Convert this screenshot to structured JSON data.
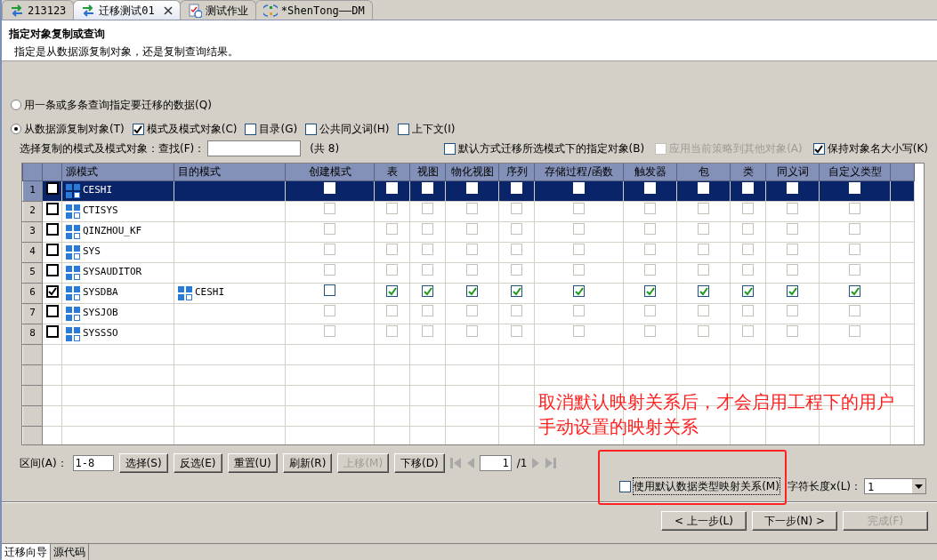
{
  "editor_tabs": [
    {
      "label": "213123",
      "kind": "connection",
      "selected": false,
      "closable": false
    },
    {
      "label": "迁移测试01",
      "kind": "connection",
      "selected": true,
      "closable": true
    },
    {
      "label": "测试作业",
      "kind": "job",
      "selected": false,
      "closable": false
    },
    {
      "label": "*ShenTong——DM",
      "kind": "model",
      "selected": false,
      "closable": false
    }
  ],
  "header": {
    "title": "指定对象复制或查询",
    "subtitle": "指定是从数据源复制对象，还是复制查询结果。"
  },
  "source_radios": [
    {
      "label": "用一条或多条查询指定要迁移的数据(Q)",
      "selected": false
    },
    {
      "label": "从数据源复制对象(T)",
      "selected": true
    }
  ],
  "object_types": [
    {
      "label": "模式及模式对象(C)",
      "checked": true
    },
    {
      "label": "目录(G)",
      "checked": false
    },
    {
      "label": "公共同义词(H)",
      "checked": false
    },
    {
      "label": "上下文(I)",
      "checked": false
    }
  ],
  "find": {
    "label": "选择复制的模式及模式对象：查找(F)：",
    "count": "(共 8)"
  },
  "options": [
    {
      "label": "默认方式迁移所选模式下的指定对象(B)",
      "checked": false,
      "disabled": false
    },
    {
      "label": "应用当前策略到其他对象(A)",
      "checked": false,
      "disabled": true
    },
    {
      "label": "保持对象名大小写(K)",
      "checked": true,
      "disabled": false
    }
  ],
  "table": {
    "columns": [
      "源模式",
      "目的模式",
      "创建模式",
      "表",
      "视图",
      "物化视图",
      "序列",
      "存储过程/函数",
      "触发器",
      "包",
      "类",
      "同义词",
      "自定义类型"
    ],
    "rows": [
      {
        "num": "1",
        "selected": true,
        "checked": false,
        "source": "CESHI",
        "target": "",
        "flags": [
          {
            "checked": false,
            "disabled": false
          },
          {
            "checked": false,
            "disabled": false
          },
          {
            "checked": false,
            "disabled": false
          },
          {
            "checked": false,
            "disabled": false
          },
          {
            "checked": false,
            "disabled": false
          },
          {
            "checked": false,
            "disabled": false
          },
          {
            "checked": false,
            "disabled": false
          },
          {
            "checked": false,
            "disabled": false
          },
          {
            "checked": false,
            "disabled": false
          },
          {
            "checked": false,
            "disabled": false
          },
          {
            "checked": false,
            "disabled": false
          }
        ]
      },
      {
        "num": "2",
        "selected": false,
        "checked": false,
        "source": "CTISYS",
        "target": "",
        "flags": [
          {
            "checked": false,
            "disabled": true
          },
          {
            "checked": false,
            "disabled": true
          },
          {
            "checked": false,
            "disabled": true
          },
          {
            "checked": false,
            "disabled": true
          },
          {
            "checked": false,
            "disabled": true
          },
          {
            "checked": false,
            "disabled": true
          },
          {
            "checked": false,
            "disabled": true
          },
          {
            "checked": false,
            "disabled": true
          },
          {
            "checked": false,
            "disabled": true
          },
          {
            "checked": false,
            "disabled": true
          },
          {
            "checked": false,
            "disabled": true
          }
        ]
      },
      {
        "num": "3",
        "selected": false,
        "checked": false,
        "source": "QINZHOU_KF",
        "target": "",
        "flags": [
          {
            "checked": false,
            "disabled": true
          },
          {
            "checked": false,
            "disabled": true
          },
          {
            "checked": false,
            "disabled": true
          },
          {
            "checked": false,
            "disabled": true
          },
          {
            "checked": false,
            "disabled": true
          },
          {
            "checked": false,
            "disabled": true
          },
          {
            "checked": false,
            "disabled": true
          },
          {
            "checked": false,
            "disabled": true
          },
          {
            "checked": false,
            "disabled": true
          },
          {
            "checked": false,
            "disabled": true
          },
          {
            "checked": false,
            "disabled": true
          }
        ]
      },
      {
        "num": "4",
        "selected": false,
        "checked": false,
        "source": "SYS",
        "target": "",
        "flags": [
          {
            "checked": false,
            "disabled": true
          },
          {
            "checked": false,
            "disabled": true
          },
          {
            "checked": false,
            "disabled": true
          },
          {
            "checked": false,
            "disabled": true
          },
          {
            "checked": false,
            "disabled": true
          },
          {
            "checked": false,
            "disabled": true
          },
          {
            "checked": false,
            "disabled": true
          },
          {
            "checked": false,
            "disabled": true
          },
          {
            "checked": false,
            "disabled": true
          },
          {
            "checked": false,
            "disabled": true
          },
          {
            "checked": false,
            "disabled": true
          }
        ]
      },
      {
        "num": "5",
        "selected": false,
        "checked": false,
        "source": "SYSAUDITOR",
        "target": "",
        "flags": [
          {
            "checked": false,
            "disabled": true
          },
          {
            "checked": false,
            "disabled": true
          },
          {
            "checked": false,
            "disabled": true
          },
          {
            "checked": false,
            "disabled": true
          },
          {
            "checked": false,
            "disabled": true
          },
          {
            "checked": false,
            "disabled": true
          },
          {
            "checked": false,
            "disabled": true
          },
          {
            "checked": false,
            "disabled": true
          },
          {
            "checked": false,
            "disabled": true
          },
          {
            "checked": false,
            "disabled": true
          },
          {
            "checked": false,
            "disabled": true
          }
        ]
      },
      {
        "num": "6",
        "selected": false,
        "checked": true,
        "source": "SYSDBA",
        "target": "CESHI",
        "flags": [
          {
            "checked": false,
            "disabled": false
          },
          {
            "checked": true,
            "disabled": false
          },
          {
            "checked": true,
            "disabled": false
          },
          {
            "checked": true,
            "disabled": false
          },
          {
            "checked": true,
            "disabled": false
          },
          {
            "checked": true,
            "disabled": false
          },
          {
            "checked": true,
            "disabled": false
          },
          {
            "checked": true,
            "disabled": false
          },
          {
            "checked": true,
            "disabled": false
          },
          {
            "checked": true,
            "disabled": false
          },
          {
            "checked": true,
            "disabled": false
          }
        ]
      },
      {
        "num": "7",
        "selected": false,
        "checked": false,
        "source": "SYSJOB",
        "target": "",
        "flags": [
          {
            "checked": false,
            "disabled": true
          },
          {
            "checked": false,
            "disabled": true
          },
          {
            "checked": false,
            "disabled": true
          },
          {
            "checked": false,
            "disabled": true
          },
          {
            "checked": false,
            "disabled": true
          },
          {
            "checked": false,
            "disabled": true
          },
          {
            "checked": false,
            "disabled": true
          },
          {
            "checked": false,
            "disabled": true
          },
          {
            "checked": false,
            "disabled": true
          },
          {
            "checked": false,
            "disabled": true
          },
          {
            "checked": false,
            "disabled": true
          }
        ]
      },
      {
        "num": "8",
        "selected": false,
        "checked": false,
        "source": "SYSSSO",
        "target": "",
        "flags": [
          {
            "checked": false,
            "disabled": true
          },
          {
            "checked": false,
            "disabled": true
          },
          {
            "checked": false,
            "disabled": true
          },
          {
            "checked": false,
            "disabled": true
          },
          {
            "checked": false,
            "disabled": true
          },
          {
            "checked": false,
            "disabled": true
          },
          {
            "checked": false,
            "disabled": true
          },
          {
            "checked": false,
            "disabled": true
          },
          {
            "checked": false,
            "disabled": true
          },
          {
            "checked": false,
            "disabled": true
          },
          {
            "checked": false,
            "disabled": true
          }
        ]
      }
    ]
  },
  "range": {
    "label": "区间(A)：",
    "value": "1-8"
  },
  "row_buttons": [
    {
      "label": "选择(S)",
      "disabled": false
    },
    {
      "label": "反选(E)",
      "disabled": false
    },
    {
      "label": "重置(U)",
      "disabled": false
    },
    {
      "label": "刷新(R)",
      "disabled": false
    },
    {
      "label": "上移(M)",
      "disabled": true
    },
    {
      "label": "下移(D)",
      "disabled": false
    }
  ],
  "pager": {
    "page": "1",
    "total": "/1"
  },
  "mapping": {
    "label": "使用默认数据类型映射关系(M)",
    "checked": false
  },
  "char_length": {
    "label": "字符长度x(L)：",
    "value": "1"
  },
  "annotation": {
    "text": "取消默认映射关系后，才会启用工程下的用户手动设置的映射关系"
  },
  "wizard_buttons": [
    {
      "label": "< 上一步(L)",
      "disabled": false
    },
    {
      "label": "下一步(N) >",
      "disabled": false
    },
    {
      "label": "完成(F)",
      "disabled": true
    }
  ],
  "bottom_tabs": [
    {
      "label": "迁移向导",
      "selected": true
    },
    {
      "label": "源代码",
      "selected": false
    }
  ]
}
